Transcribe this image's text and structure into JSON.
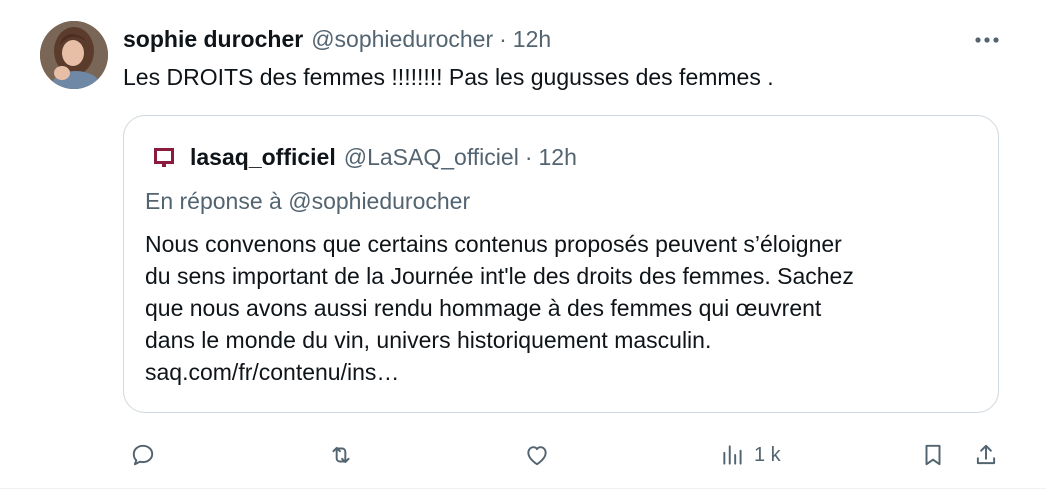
{
  "tweet": {
    "author_name": "sophie durocher",
    "author_handle": "@sophiedurocher",
    "separator": "·",
    "time": "12h",
    "text": "Les DROITS des femmes !!!!!!!! Pas les gugusses des femmes ."
  },
  "quote": {
    "author_name": "lasaq_officiel",
    "author_handle": "@LaSAQ_officiel",
    "separator": "·",
    "time": "12h",
    "reply_prefix": "En réponse à",
    "reply_to": "@sophiedurocher",
    "lines": [
      "Nous convenons que certains contenus proposés peuvent s’éloigner",
      "du sens important de la Journée int'le des droits des femmes. Sachez",
      "que nous avons aussi rendu hommage à des femmes qui œuvrent",
      "dans le monde du vin, univers historiquement masculin.",
      "saq.com/fr/contenu/ins…"
    ]
  },
  "actions": {
    "views_count": "1 k"
  },
  "icons": {
    "more": "more-horizontal-icon",
    "reply": "reply-icon",
    "retweet": "retweet-icon",
    "like": "heart-icon",
    "views": "views-chart-icon",
    "bookmark": "bookmark-icon",
    "share": "share-icon",
    "quote_logo": "saq-logo-icon"
  },
  "colors": {
    "text": "#0f1419",
    "secondary": "#536471",
    "border": "#cfd9de",
    "saq_brand": "#8a1b3d"
  }
}
